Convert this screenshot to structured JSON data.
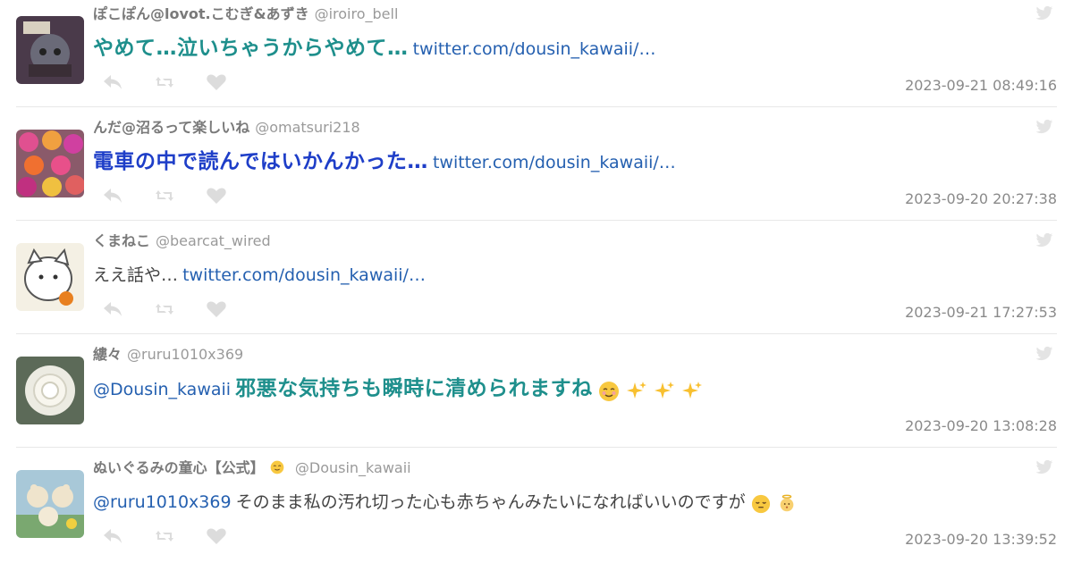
{
  "tweets": [
    {
      "name": "ぽこぽん@lovot.こむぎ&あずき",
      "handle": "@iroiro_bell",
      "text": "やめて…泣いちゃうからやめて…",
      "link": "twitter.com/dousin_kawaii/…",
      "time": "2023-09-21 08:49:16",
      "text_color": "#1e8f8c"
    },
    {
      "name": "んだ@沼るって楽しいね",
      "handle": "@omatsuri218",
      "text": "電車の中で読んではいかんかった…",
      "link": "twitter.com/dousin_kawaii/…",
      "time": "2023-09-20 20:27:38",
      "text_color": "#1e3ec8"
    },
    {
      "name": "くまねこ",
      "handle": "@bearcat_wired",
      "text": "ええ話や…",
      "link": "twitter.com/dousin_kawaii/…",
      "time": "2023-09-21 17:27:53"
    },
    {
      "name": "縷々",
      "handle": "@ruru1010x369",
      "mention": "@Dousin_kawaii",
      "text": "邪悪な気持ちも瞬時に清められますね",
      "time": "2023-09-20 13:08:28",
      "text_color": "#1e8f8c"
    },
    {
      "name": "ぬいぐるみの童心【公式】",
      "handle": "@Dousin_kawaii",
      "mention": "@ruru1010x369",
      "text": "そのまま私の汚れ切った心も赤ちゃんみたいになればいいのですが",
      "time": "2023-09-20 13:39:52"
    }
  ],
  "icons": {
    "reply": "reply-icon",
    "retweet": "retweet-icon",
    "like": "heart-icon",
    "twitter": "twitter-bird-icon"
  }
}
